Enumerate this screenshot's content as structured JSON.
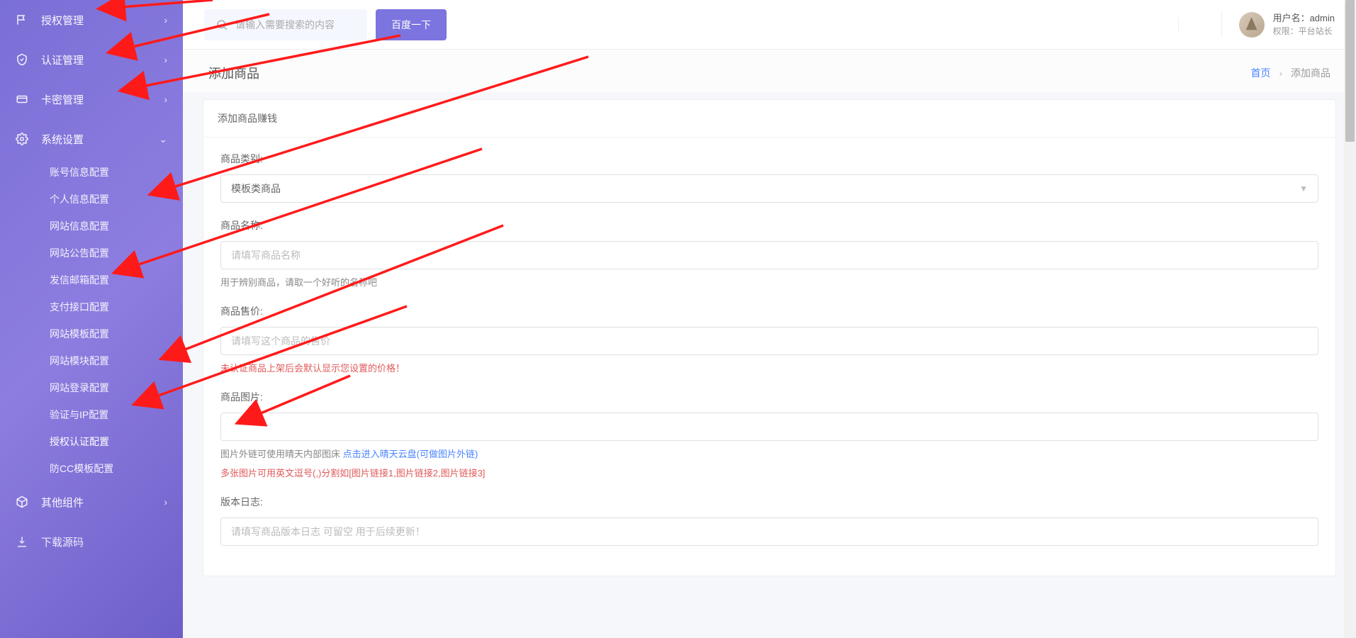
{
  "sidebar": {
    "topItems": [
      {
        "icon": "flag",
        "label": "授权管理",
        "chevron": "›"
      },
      {
        "icon": "shield",
        "label": "认证管理",
        "chevron": "›"
      },
      {
        "icon": "card",
        "label": "卡密管理",
        "chevron": "›"
      }
    ],
    "settingsGroup": {
      "icon": "gear",
      "label": "系统设置",
      "chevron": "⌄",
      "items": [
        "账号信息配置",
        "个人信息配置",
        "网站信息配置",
        "网站公告配置",
        "发信邮箱配置",
        "支付接口配置",
        "网站模板配置",
        "网站模块配置",
        "网站登录配置",
        "验证与IP配置",
        "授权认证配置",
        "防CC模板配置"
      ],
      "activeIndex": 10
    },
    "bottomItems": [
      {
        "icon": "cube",
        "label": "其他组件",
        "chevron": "›"
      },
      {
        "icon": "download",
        "label": "下载源码",
        "chevron": ""
      }
    ]
  },
  "header": {
    "searchPlaceholder": "请输入需要搜索的内容",
    "searchBtn": "百度一下",
    "usernameLabel": "用户名：",
    "username": "admin",
    "roleLabel": "权限：",
    "role": "平台站长"
  },
  "page": {
    "title": "添加商品",
    "breadcrumb": {
      "home": "首页",
      "current": "添加商品"
    },
    "cardTitle": "添加商品赚钱"
  },
  "form": {
    "category": {
      "label": "商品类别:",
      "value": "模板类商品"
    },
    "name": {
      "label": "商品名称:",
      "placeholder": "请填写商品名称",
      "help": "用于辨别商品，请取一个好听的名称吧"
    },
    "price": {
      "label": "商品售价:",
      "placeholder": "请填写这个商品的售价",
      "help": "未认证商品上架后会默认显示您设置的价格！"
    },
    "image": {
      "label": "商品图片:",
      "help1": "图片外链可使用晴天内部图床 ",
      "helpLink": "点击进入晴天云盘(可做图片外链)",
      "help2": "多张图片可用英文逗号(,)分割如[图片链接1,图片链接2,图片链接3]"
    },
    "log": {
      "label": "版本日志:",
      "placeholder": "请填写商品版本日志 可留空 用于后续更新！"
    }
  }
}
